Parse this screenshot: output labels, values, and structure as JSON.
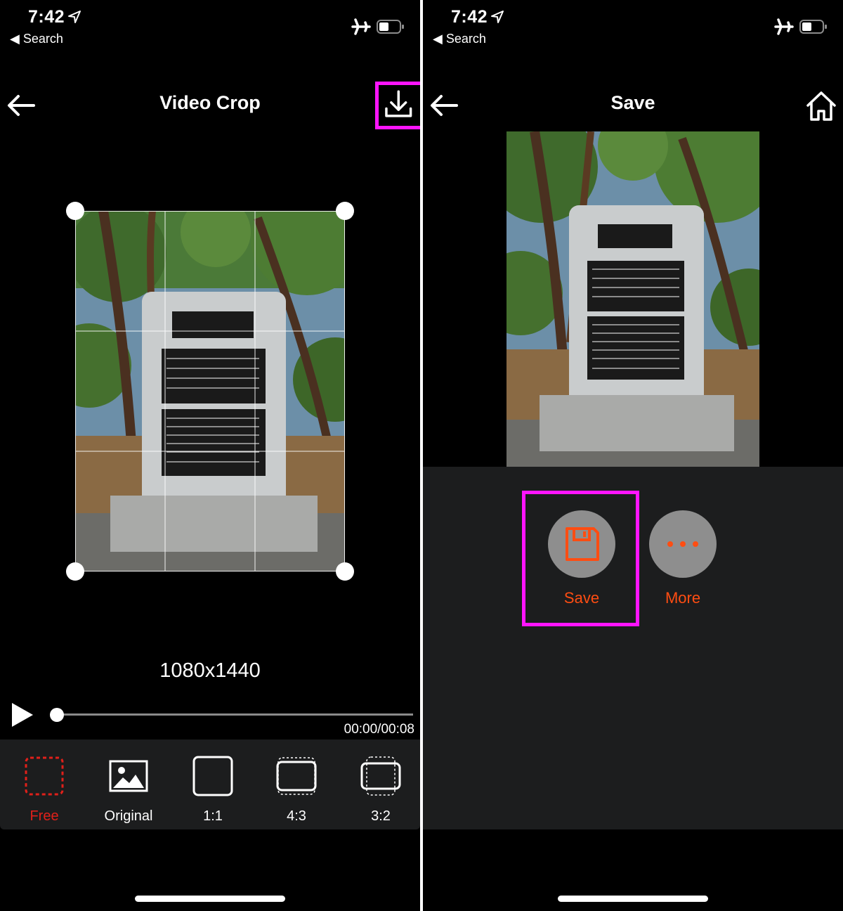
{
  "status_bar": {
    "time": "7:42",
    "back_label": "Search"
  },
  "crop_screen": {
    "title": "Video Crop",
    "resolution": "1080x1440",
    "playback_time": "00:00/00:08",
    "playback_progress": 0,
    "ratios": [
      {
        "label": "Free",
        "icon": "dashed-square-icon",
        "selected": true
      },
      {
        "label": "Original",
        "icon": "image-icon",
        "selected": false
      },
      {
        "label": "1:1",
        "icon": "square-icon",
        "selected": false
      },
      {
        "label": "4:3",
        "icon": "ratio-4-3-icon",
        "selected": false
      },
      {
        "label": "3:2",
        "icon": "ratio-3-2-icon",
        "selected": false
      }
    ]
  },
  "save_screen": {
    "title": "Save",
    "actions": [
      {
        "label": "Save",
        "icon": "floppy-disk-icon"
      },
      {
        "label": "More",
        "icon": "more-dots-icon"
      }
    ]
  },
  "colors": {
    "accent": "#ff4d12",
    "highlight": "#ff14ff",
    "toolbar_bg": "#1c1d1e"
  }
}
